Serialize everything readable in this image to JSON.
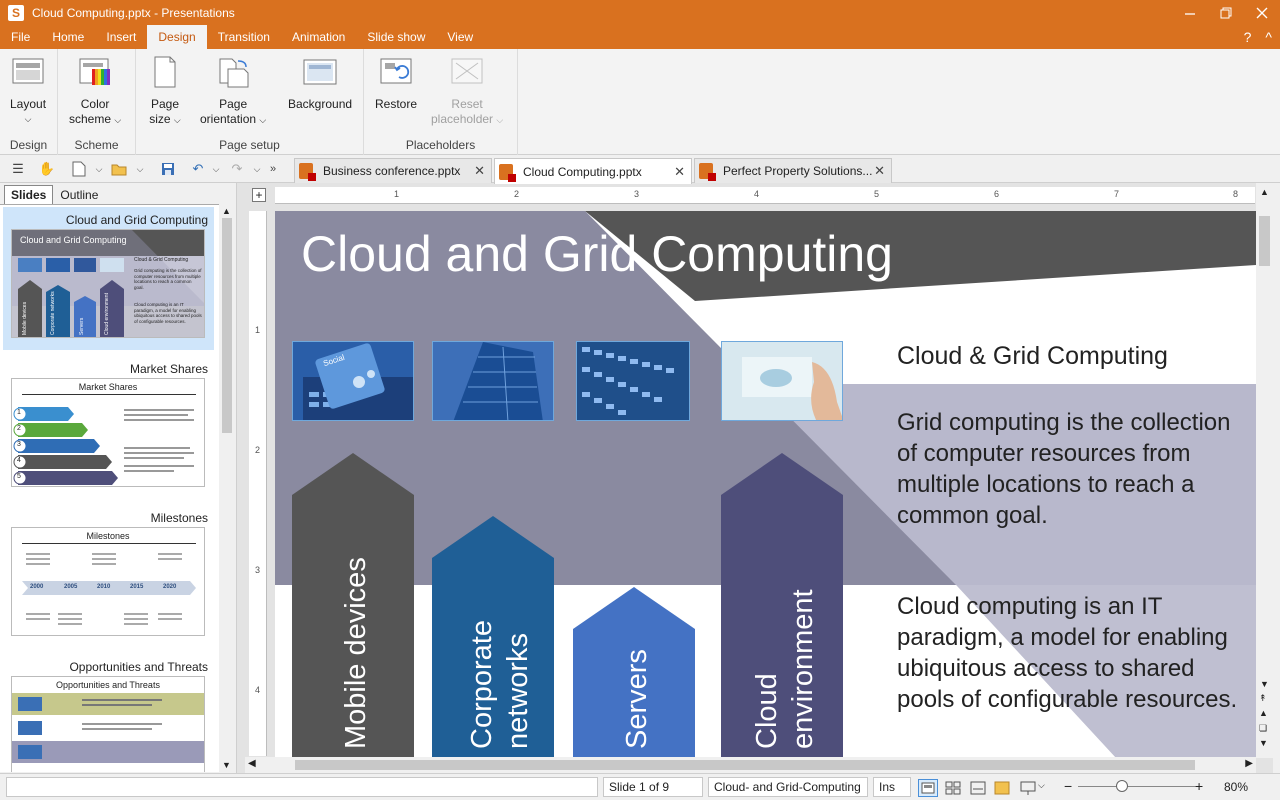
{
  "window": {
    "app_icon_letter": "S",
    "title": "Cloud Computing.pptx - Presentations",
    "controls": [
      "minimize",
      "maximize",
      "close"
    ]
  },
  "menu": {
    "tabs": [
      "File",
      "Home",
      "Insert",
      "Design",
      "Transition",
      "Animation",
      "Slide show",
      "View"
    ],
    "active": "Design",
    "help": "?",
    "collapse": "^"
  },
  "ribbon": {
    "groups": {
      "design": "Design",
      "scheme": "Scheme",
      "page_setup": "Page setup",
      "placeholders": "Placeholders"
    },
    "buttons": {
      "layout": "Layout",
      "color_scheme_1": "Color",
      "color_scheme_2": "scheme",
      "page_size_1": "Page",
      "page_size_2": "size",
      "page_orientation_1": "Page",
      "page_orientation_2": "orientation",
      "background": "Background",
      "restore": "Restore",
      "reset_placeholder_1": "Reset",
      "reset_placeholder_2": "placeholder"
    }
  },
  "doc_tabs": [
    {
      "label": "Business conference.pptx",
      "active": false
    },
    {
      "label": "Cloud Computing.pptx",
      "active": true
    },
    {
      "label": "Perfect Property Solutions...",
      "active": false
    }
  ],
  "panel": {
    "tabs": [
      "Slides",
      "Outline"
    ],
    "active_tab": "Slides",
    "slides": [
      {
        "title": "Cloud and Grid Computing",
        "selected": true
      },
      {
        "title": "Market Shares",
        "selected": false
      },
      {
        "title": "Milestones",
        "selected": false
      },
      {
        "title": "Opportunities and Threats",
        "selected": false
      }
    ],
    "thumb1": {
      "header": "Cloud and Grid Computing",
      "subtitle": "Cloud & Grid Computing",
      "p1": "Grid computing is the collection of computer resources from multiple locations to reach a common goal.",
      "p2": "Cloud computing is an IT paradigm, a model for enabling ubiquitous access to shared pools of configurable resources.",
      "pillars": [
        "Mobile devices",
        "Corporate networks",
        "Servers",
        "Cloud environment"
      ]
    },
    "thumb2": {
      "header": "Market Shares",
      "numbers": [
        "1",
        "2",
        "3",
        "4",
        "5"
      ]
    },
    "thumb3": {
      "header": "Milestones",
      "years": [
        "2000",
        "2005",
        "2010",
        "2015",
        "2020"
      ]
    },
    "thumb4": {
      "header": "Opportunities and Threats"
    }
  },
  "ruler": {
    "top_numbers": [
      "1",
      "2",
      "3",
      "4",
      "5",
      "6",
      "7",
      "8"
    ],
    "left_numbers": [
      "1",
      "2",
      "3",
      "4"
    ]
  },
  "slide": {
    "title": "Cloud and Grid Computing",
    "subtitle": "Cloud & Grid Computing",
    "paragraph1": "Grid computing is the collection of computer resources from multiple locations to reach a common goal.",
    "paragraph2": "Cloud computing is an IT paradigm, a model for enabling ubiquitous access to shared pools of configurable resources.",
    "photo_caption": "Social",
    "pillars": [
      {
        "line1": "Mobile devices",
        "line2": "",
        "color": "#555555"
      },
      {
        "line1": "Corporate",
        "line2": "networks",
        "color": "#1f5f96"
      },
      {
        "line1": "Servers",
        "line2": "",
        "color": "#4472c4"
      },
      {
        "line1": "Cloud",
        "line2": "environment",
        "color": "#4e4e7a"
      }
    ],
    "colors": {
      "title_band": "#555555",
      "triangle": "#8a8aa0",
      "band": "#b8b8cc"
    }
  },
  "status": {
    "slide_info": "Slide 1 of 9",
    "slide_name": "Cloud- and Grid-Computing",
    "mode": "Ins",
    "zoom": "80%",
    "zoom_minus": "−",
    "zoom_plus": "+"
  }
}
